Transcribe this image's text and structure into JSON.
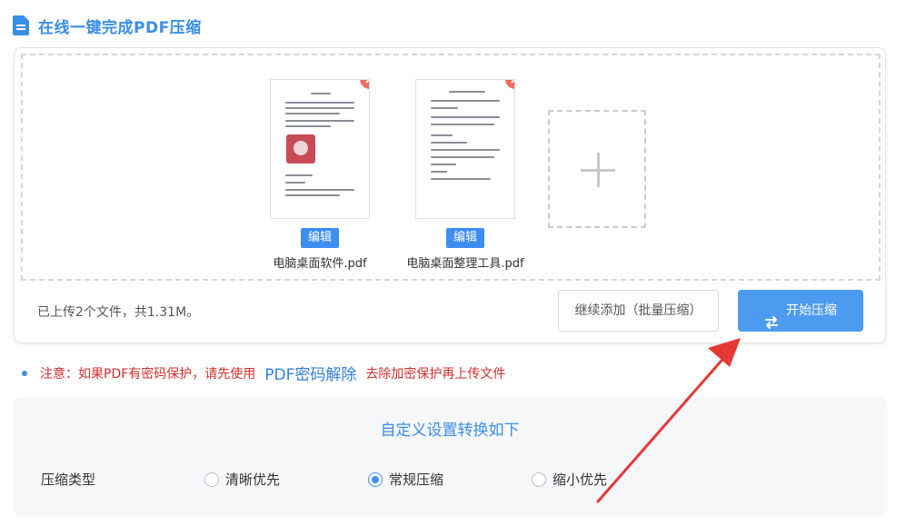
{
  "header": {
    "title": "在线一键完成PDF压缩",
    "icon": "document-icon"
  },
  "files": [
    {
      "name": "电脑桌面软件.pdf",
      "edit_label": "编辑",
      "close_symbol": "×"
    },
    {
      "name": "电脑桌面整理工具.pdf",
      "edit_label": "编辑",
      "close_symbol": "×"
    }
  ],
  "upload": {
    "status": "已上传2个文件，共1.31M。",
    "continue_label": "继续添加（批量压缩）",
    "start_label": "开始压缩"
  },
  "note": {
    "prefix": "注意：如果PDF有密码保护，请先使用",
    "link": "PDF密码解除",
    "suffix": "去除加密保护再上传文件"
  },
  "settings": {
    "title": "自定义设置转换如下",
    "compression_label": "压缩类型",
    "options": [
      {
        "label": "清晰优先",
        "checked": false
      },
      {
        "label": "常规压缩",
        "checked": true
      },
      {
        "label": "缩小优先",
        "checked": false
      }
    ]
  },
  "colors": {
    "accent": "#3a8ee6",
    "button": "#4d9bf0",
    "close": "#f26b5b",
    "warning": "#d32f2f",
    "arrow": "#e53935"
  }
}
